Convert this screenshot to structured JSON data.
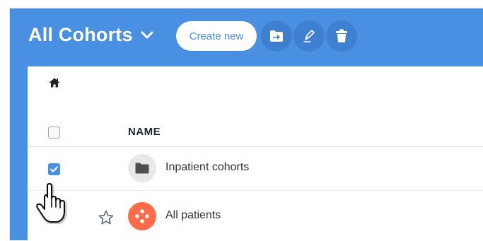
{
  "header": {
    "title": "All Cohorts",
    "create_label": "Create new"
  },
  "icons": {
    "title_dropdown": "chevron-down-icon",
    "move": "move-to-folder-icon",
    "edit": "pen-icon",
    "delete": "trash-icon",
    "home": "home-icon",
    "folder": "folder-icon",
    "patients": "patients-icon",
    "favorite": "star-icon",
    "cursor": "hand-pointer-icon"
  },
  "table": {
    "columns": [
      "NAME"
    ],
    "rows": [
      {
        "name": "Inpatient cohorts",
        "type": "folder",
        "selected": true
      },
      {
        "name": "All patients",
        "type": "cohort",
        "selected": false
      }
    ]
  },
  "colors": {
    "primary": "#4a90e2",
    "button_dark": "#3f7fcf",
    "patients_accent": "#ff6b4a"
  }
}
